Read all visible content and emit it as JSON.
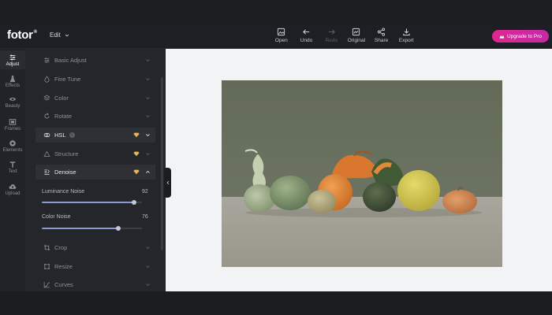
{
  "app": {
    "logo": "fotor",
    "logo_mark": "®"
  },
  "menu": {
    "edit_label": "Edit"
  },
  "toolbar": {
    "open": "Open",
    "undo": "Undo",
    "redo": "Redo",
    "original": "Original",
    "share": "Share",
    "export": "Export"
  },
  "upgrade": {
    "label": "Upgrade to Pro",
    "icon": "crown-icon",
    "color": "#e0268f"
  },
  "rail": {
    "adjust": "Adjust",
    "effects": "Effects",
    "beauty": "Beauty",
    "frames": "Frames",
    "elements": "Elements",
    "text": "Text",
    "upload": "Upload"
  },
  "panel": {
    "basic_adjust": "Basic Adjust",
    "fine_tune": "Fine Tune",
    "color": "Color",
    "rotate": "Rotate",
    "hsl": "HSL",
    "hsl_info": "i",
    "structure": "Structure",
    "denoise": "Denoise",
    "crop": "Crop",
    "resize": "Resize",
    "curves": "Curves"
  },
  "sliders": {
    "luminance_noise": {
      "label": "Luminance Noise",
      "value": "92",
      "level": 0.92
    },
    "color_noise": {
      "label": "Color Noise",
      "value": "76",
      "level": 0.76
    }
  },
  "colors": {
    "accent": "#8a9bd1",
    "premium_gem": "#e8b64a",
    "panel_bg": "#25262b",
    "canvas_bg": "#f2f3f5"
  }
}
